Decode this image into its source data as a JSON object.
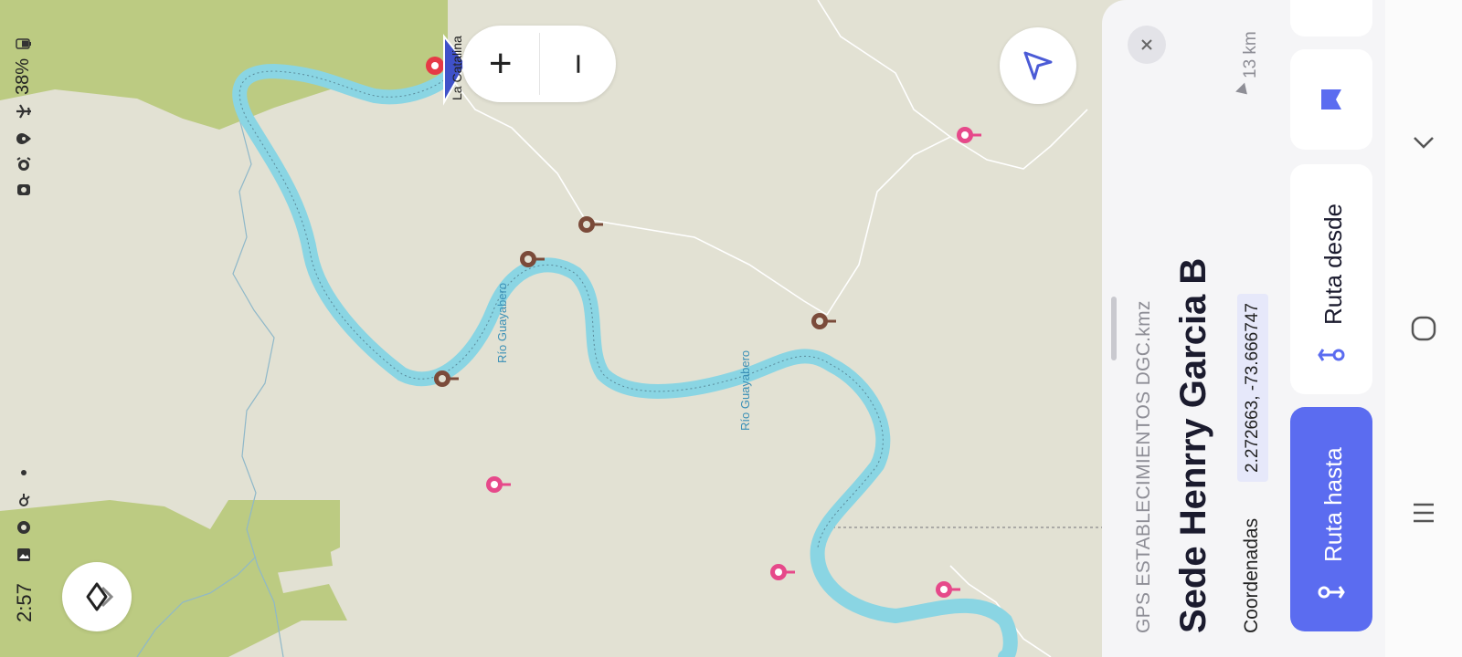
{
  "status_bar": {
    "time": "2:57",
    "battery": "38%",
    "icons": [
      "photo-icon",
      "settings-icon",
      "activity-icon",
      "dot-icon",
      "screenshot-icon",
      "alarm-icon",
      "location-icon",
      "airplane-mode-icon",
      "battery-icon"
    ]
  },
  "map": {
    "river_labels": [
      "Río Guayabero",
      "Río Guayabero"
    ],
    "place_label": "La Catalina",
    "colors": {
      "land": "#e2e1d3",
      "forest": "#bccb82",
      "river": "#8ad5e3",
      "pin_pink": "#e6498a",
      "pin_brown": "#7b4b3a",
      "accent": "#5b6cf0"
    }
  },
  "controls": {
    "zoom_in": "+",
    "zoom_out": "−",
    "icons": [
      "locate-arrow-icon",
      "layers-icon"
    ]
  },
  "place_panel": {
    "category": "GPS ESTABLECIMIENTOS DGC.kmz",
    "title": "Sede Henrry Garcia B",
    "coords_label": "Coordenadas",
    "coords_value": "2.272663, -73.666747",
    "distance": "13 km",
    "route_to": "Ruta hasta",
    "route_from": "Ruta desde"
  },
  "nav_bar": {
    "icons": [
      "back-icon",
      "home-icon",
      "recents-icon"
    ]
  }
}
